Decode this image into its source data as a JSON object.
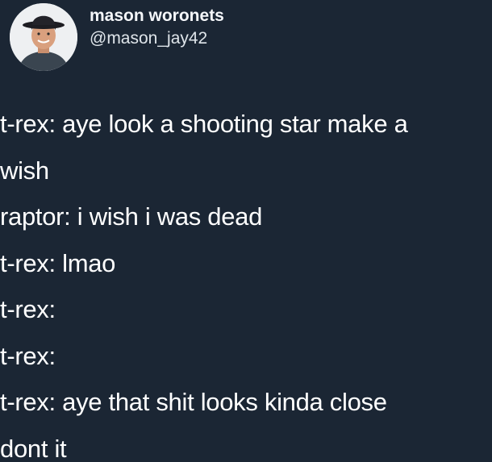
{
  "author": {
    "display_name": "mason woronets",
    "handle": "@mason_jay42"
  },
  "tweet": {
    "lines": [
      "t-rex: aye look a shooting star make a",
      "wish",
      "raptor: i wish i was dead",
      "t-rex: lmao",
      "t-rex:",
      "t-rex:",
      "t-rex: aye that shit looks kinda close",
      "dont it"
    ]
  },
  "colors": {
    "background": "#1b2634",
    "text": "#ffffff"
  }
}
